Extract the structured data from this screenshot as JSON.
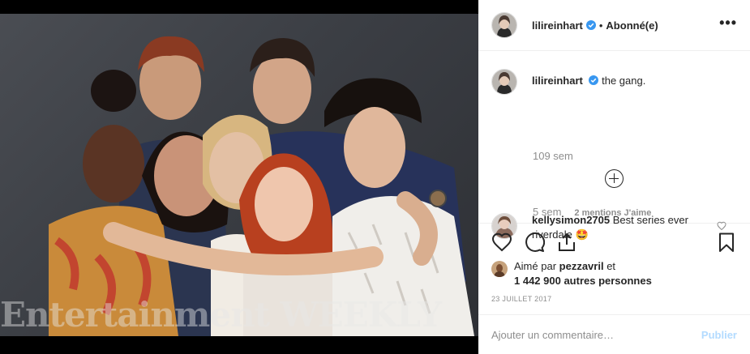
{
  "photo": {
    "watermark": "Entertainment WEEKLY"
  },
  "header": {
    "username": "lilireinhart",
    "follow_label": "Abonné(e)",
    "separator": "•",
    "more": "•••"
  },
  "caption": {
    "username": "lilireinhart",
    "text": "the gang.",
    "time": "109 sem"
  },
  "comment": {
    "username": "kellysimon2705",
    "text": "Best series ever riverdale 🤩",
    "time": "5 sem",
    "likes": "2 mentions J'aime"
  },
  "liked_by": {
    "prefix": "Aimé par",
    "user": "pezzavril",
    "and": "et",
    "others": "1 442 900 autres personnes"
  },
  "date": "23 JUILLET 2017",
  "add_comment": {
    "placeholder": "Ajouter un commentaire…",
    "post_label": "Publier"
  },
  "colors": {
    "verified": "#3897f0",
    "muted": "#8e8e8e",
    "post_disabled": "#b3dbff"
  }
}
